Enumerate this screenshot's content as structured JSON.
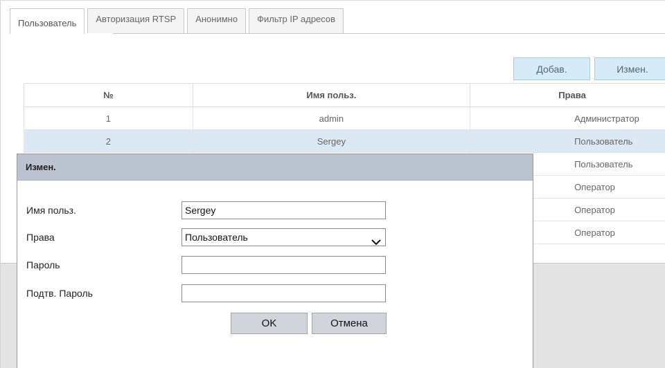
{
  "tabs": [
    {
      "label": "Пользователь",
      "active": true
    },
    {
      "label": "Авторизация RTSP",
      "active": false
    },
    {
      "label": "Анонимно",
      "active": false
    },
    {
      "label": "Фильтр IP адресов",
      "active": false
    }
  ],
  "toolbar": {
    "add_label": "Добав.",
    "edit_label": "Измен."
  },
  "table": {
    "headers": [
      "№",
      "Имя польз.",
      "Права"
    ],
    "rows": [
      {
        "num": "1",
        "name": "admin",
        "rights": "Администратор",
        "selected": false
      },
      {
        "num": "2",
        "name": "Sergey",
        "rights": "Пользователь",
        "selected": true
      },
      {
        "num": "",
        "name": "",
        "rights": "Пользователь",
        "selected": false
      },
      {
        "num": "",
        "name": "",
        "rights": "Оператор",
        "selected": false
      },
      {
        "num": "",
        "name": "",
        "rights": "Оператор",
        "selected": false
      },
      {
        "num": "",
        "name": "",
        "rights": "Оператор",
        "selected": false
      }
    ]
  },
  "dialog": {
    "title": "Измен.",
    "fields": {
      "username_label": "Имя польз.",
      "username_value": "Sergey",
      "rights_label": "Права",
      "rights_value": "Пользователь",
      "password_label": "Пароль",
      "password_value": "",
      "confirm_label": "Подтв. Пароль",
      "confirm_value": ""
    },
    "ok_label": "OK",
    "cancel_label": "Отмена"
  },
  "colors": {
    "selected_row": "#dde8f5",
    "blue_button": "#d6ebf5",
    "dialog_header": "#bac3cf",
    "dim_overlay": "#e4e4e4"
  },
  "icons": {
    "rights_dropdown": "chevron-down-icon"
  }
}
